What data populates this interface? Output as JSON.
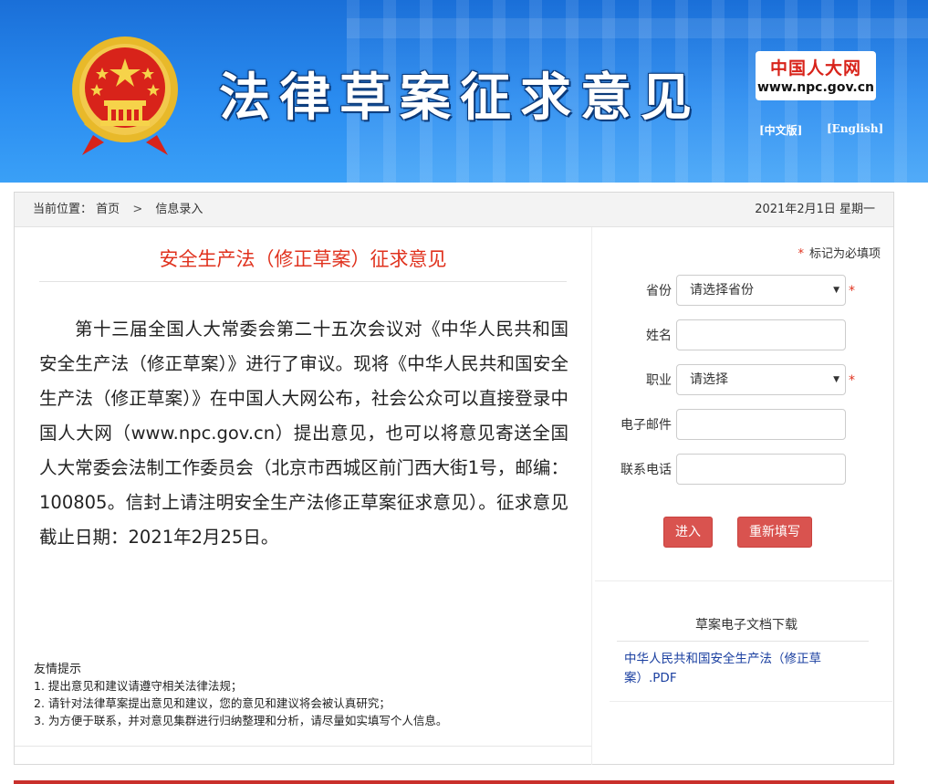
{
  "header": {
    "title": "法律草案征求意见",
    "npc_name": "中国人大网",
    "npc_url": "www.npc.gov.cn",
    "lang_cn": "[中文版]",
    "lang_en": "[English]"
  },
  "breadcrumb": {
    "prefix": "当前位置：",
    "home": "首页",
    "separator": ">",
    "current": "信息录入"
  },
  "date": "2021年2月1日  星期一",
  "doc": {
    "title": "安全生产法（修正草案）征求意见",
    "body": "第十三届全国人大常委会第二十五次会议对《中华人民共和国安全生产法（修正草案）》进行了审议。现将《中华人民共和国安全生产法（修正草案）》在中国人大网公布，社会公众可以直接登录中国人大网（www.npc.gov.cn）提出意见，也可以将意见寄送全国人大常委会法制工作委员会（北京市西城区前门西大街1号，邮编：100805。信封上请注明安全生产法修正草案征求意见）。征求意见截止日期：2021年2月25日。"
  },
  "tips": {
    "title": "友情提示",
    "items": [
      "1. 提出意见和建议请遵守相关法律法规；",
      "2. 请针对法律草案提出意见和建议，您的意见和建议将会被认真研究；",
      "3. 为方便于联系，并对意见集群进行归纳整理和分析，请尽量如实填写个人信息。"
    ]
  },
  "form": {
    "required_note": "标记为必填项",
    "required_mark": "*",
    "province_label": "省份",
    "province_value": "请选择省份",
    "name_label": "姓名",
    "name_value": "",
    "job_label": "职业",
    "job_value": "请选择",
    "email_label": "电子邮件",
    "email_value": "",
    "phone_label": "联系电话",
    "phone_value": "",
    "submit": "进入",
    "reset": "重新填写"
  },
  "download": {
    "title": "草案电子文档下载",
    "link": "中华人民共和国安全生产法（修正草案）.PDF"
  },
  "colors": {
    "header_blue": "#2a8cf0",
    "accent_red": "#d9534f",
    "title_red": "#e0321e",
    "link_blue": "#1a3fa0"
  }
}
